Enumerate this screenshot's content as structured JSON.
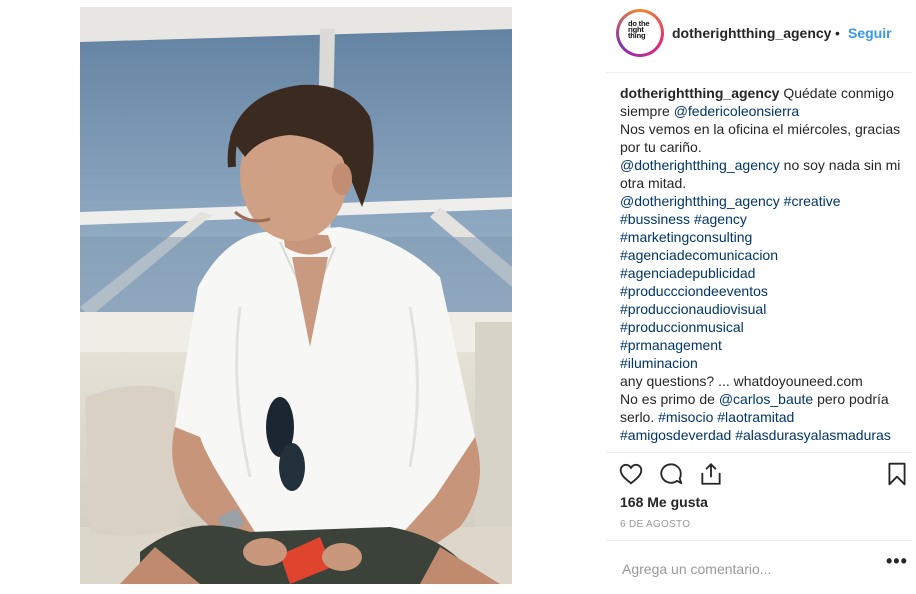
{
  "post": {
    "username": "dotherightthing_agency",
    "separator": "•",
    "follow_label": "Seguir",
    "avatar_logo": "do the right thing",
    "caption": {
      "line1_user": "dotherightthing_agency",
      "line1_text": " Quédate conmigo siempre ",
      "mention1": "@federicoleonsierra",
      "line2": "Nos vemos en la oficina el miércoles, gracias por tu cariño.",
      "mention2": "@dotherightthing_agency",
      "line3_text": " no soy nada sin mi otra mitad.",
      "mention3": "@dotherightthing_agency",
      "tag_creative": "#creative",
      "tag_bussiness": "#bussiness",
      "tag_agency": "#agency",
      "tag_marketing": "#marketingconsulting",
      "tag_agenciacom": "#agenciadecomunicacion",
      "tag_agenciapub": "#agenciadepublicidad",
      "tag_eventos": "#produccciondeeventos",
      "tag_audiovisual": "#produccionaudiovisual",
      "tag_musical": "#produccionmusical",
      "tag_pr": "#prmanagement",
      "tag_iluminacion": "#iluminacion",
      "questions": "any questions? ... whatdoyouneed.com",
      "line_primo_a": "No es primo de ",
      "mention_carlos": "@carlos_baute",
      "line_primo_b": " pero podría serlo. ",
      "tag_misocio": "#misocio",
      "tag_laotramitad": "#laotramitad",
      "tag_amigos": "#amigosdeverdad",
      "tag_alasduras": "#alasdurasyalasmaduras"
    },
    "likes": "168 Me gusta",
    "date": "6 DE AGOSTO",
    "comment_placeholder": "Agrega un comentario...",
    "more_label": "•••"
  },
  "icons": {
    "like": "heart-icon",
    "comment": "comment-icon",
    "share": "share-icon",
    "save": "bookmark-icon"
  },
  "colors": {
    "link": "#003569",
    "follow": "#3897f0",
    "muted": "#999999",
    "text": "#262626"
  }
}
